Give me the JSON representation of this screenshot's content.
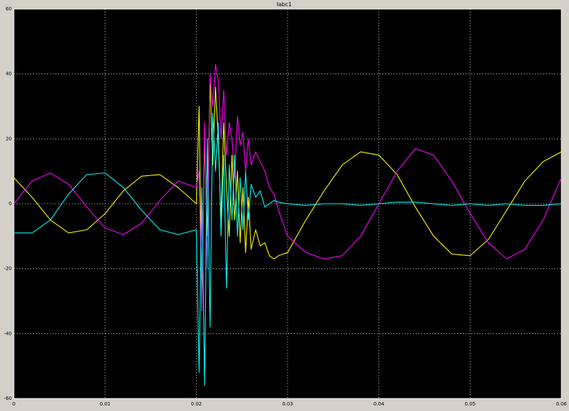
{
  "window": {
    "title": "Iabc1"
  },
  "chart_data": {
    "type": "line",
    "title": "Iabc1",
    "xlim": [
      0,
      0.06
    ],
    "ylim": [
      -60,
      60
    ],
    "xticks": [
      "0",
      "0.01",
      "0.02",
      "0.03",
      "0.04",
      "0.05",
      "0.06"
    ],
    "yticks": [
      "60",
      "40",
      "20",
      "0",
      "-20",
      "-40",
      "-60"
    ],
    "grid": true,
    "background": "#000000",
    "axes_color": "#ffffff",
    "series": [
      {
        "color": "#ffff00",
        "x": [
          0,
          0.002,
          0.004,
          0.006,
          0.008,
          0.01,
          0.012,
          0.014,
          0.016,
          0.018,
          0.02,
          0.0203,
          0.0206,
          0.0209,
          0.0212,
          0.0215,
          0.0218,
          0.0221,
          0.0224,
          0.0227,
          0.023,
          0.0233,
          0.0236,
          0.0239,
          0.0242,
          0.0245,
          0.0248,
          0.0251,
          0.0254,
          0.0257,
          0.026,
          0.0265,
          0.027,
          0.0275,
          0.028,
          0.0285,
          0.029,
          0.03,
          0.032,
          0.034,
          0.036,
          0.038,
          0.04,
          0.042,
          0.044,
          0.046,
          0.048,
          0.05,
          0.052,
          0.054,
          0.056,
          0.058,
          0.06
        ],
        "y": [
          8,
          2,
          -5,
          -9,
          -8,
          -3,
          4,
          8.5,
          9,
          5,
          0,
          30,
          -30,
          20,
          -10,
          38,
          12,
          36,
          20,
          -5,
          25,
          5,
          -10,
          15,
          -5,
          10,
          -12,
          5,
          -15,
          2,
          -14,
          -8,
          -13,
          -12,
          -16,
          -17,
          -16,
          -15,
          -5,
          4,
          12,
          16,
          15,
          9,
          -1,
          -10,
          -15.5,
          -16,
          -11,
          -2,
          7,
          13,
          16
        ]
      },
      {
        "color": "#ff00ff",
        "x": [
          0,
          0.002,
          0.004,
          0.006,
          0.008,
          0.01,
          0.012,
          0.014,
          0.016,
          0.018,
          0.02,
          0.0203,
          0.0206,
          0.0209,
          0.0212,
          0.0215,
          0.0218,
          0.0221,
          0.0224,
          0.0227,
          0.023,
          0.0233,
          0.0236,
          0.0239,
          0.0242,
          0.0245,
          0.0248,
          0.0251,
          0.0254,
          0.0257,
          0.026,
          0.0265,
          0.027,
          0.0275,
          0.028,
          0.0285,
          0.029,
          0.03,
          0.032,
          0.034,
          0.036,
          0.038,
          0.04,
          0.042,
          0.044,
          0.046,
          0.048,
          0.05,
          0.052,
          0.054,
          0.056,
          0.058,
          0.06
        ],
        "y": [
          0,
          7,
          9.5,
          6,
          -1,
          -7.5,
          -9.5,
          -6,
          1,
          7,
          5,
          10,
          -33,
          25,
          -20,
          40,
          30,
          43,
          38,
          20,
          35,
          15,
          25,
          20,
          8,
          27,
          18,
          22,
          10,
          20,
          12,
          16,
          13,
          10,
          5,
          3,
          -2,
          -10,
          -15,
          -17,
          -16,
          -10,
          0,
          10,
          17,
          15,
          7,
          -3,
          -12,
          -17,
          -14,
          -5,
          8
        ]
      },
      {
        "color": "#00ffff",
        "x": [
          0,
          0.002,
          0.004,
          0.006,
          0.008,
          0.01,
          0.012,
          0.014,
          0.016,
          0.018,
          0.02,
          0.0203,
          0.0206,
          0.0209,
          0.0212,
          0.0215,
          0.0218,
          0.0221,
          0.0224,
          0.0227,
          0.023,
          0.0233,
          0.0236,
          0.0239,
          0.0242,
          0.0245,
          0.0248,
          0.0251,
          0.0254,
          0.0257,
          0.026,
          0.0265,
          0.027,
          0.0275,
          0.028,
          0.0285,
          0.029,
          0.03,
          0.032,
          0.034,
          0.036,
          0.038,
          0.04,
          0.042,
          0.044,
          0.046,
          0.048,
          0.05,
          0.052,
          0.054,
          0.056,
          0.058,
          0.06
        ],
        "y": [
          -9,
          -9,
          -5,
          3,
          9,
          9.5,
          5,
          -2,
          -8,
          -9.5,
          -8,
          -52,
          5,
          -56,
          20,
          -38,
          28,
          10,
          25,
          -10,
          15,
          -26,
          12,
          -5,
          15,
          -10,
          8,
          -8,
          10,
          -5,
          6,
          2,
          4,
          -1,
          0,
          1,
          0.5,
          0,
          -0.5,
          0,
          0,
          -0.5,
          0,
          0.5,
          0.5,
          0,
          -0.5,
          0,
          -0.5,
          0,
          -0.5,
          -0.5,
          0
        ]
      }
    ]
  }
}
